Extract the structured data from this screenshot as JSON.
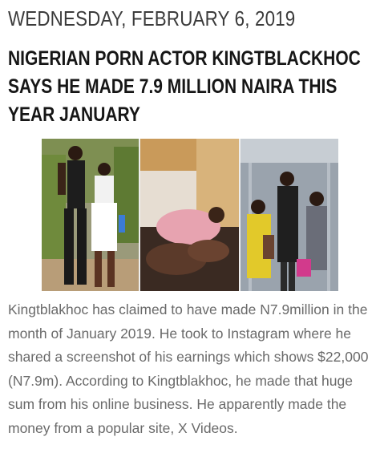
{
  "post": {
    "date": "WEDNESDAY, FEBRUARY 6, 2019",
    "title": "NIGERIAN PORN ACTOR KINGTBLACKHOC SAYS HE MADE 7.9 MILLION NAIRA THIS YEAR JANUARY",
    "body": "Kingtblakhoc has claimed to have made N7.9million in the month of January 2019. He took to Instagram where he shared a screenshot of his earnings which shows $22,000 (N7.9m). According to Kingtblakhoc, he made that huge sum from his online business. He apparently made the money from a popular site, X Videos."
  },
  "image": {
    "panels": 3,
    "colors": {
      "foliage": "#6f8a3c",
      "room": "#c99a5a",
      "elevator": "#9aa3ad",
      "accent_yellow": "#e2c92a"
    }
  }
}
